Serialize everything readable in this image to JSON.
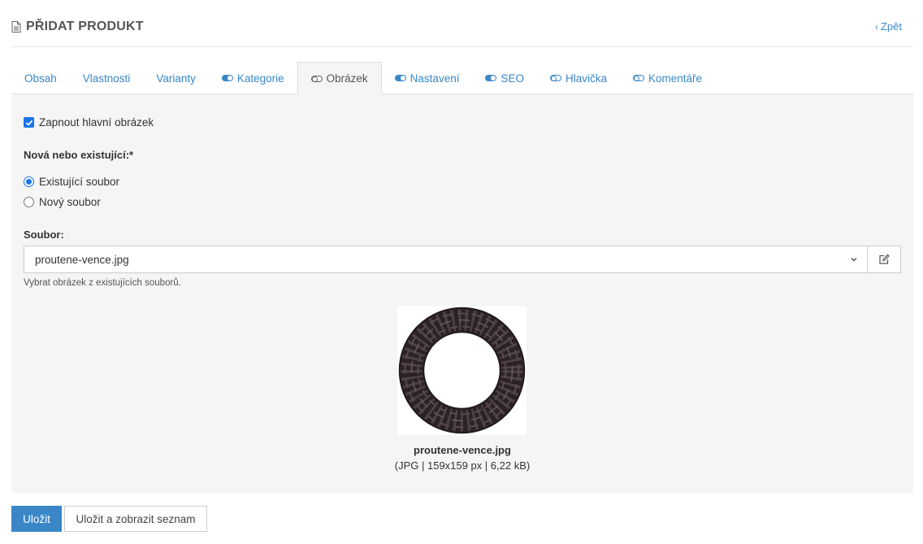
{
  "header": {
    "title": "PŘIDAT PRODUKT",
    "back_label": "Zpět"
  },
  "tabs": [
    {
      "label": "Obsah",
      "toggle": "none",
      "active": false
    },
    {
      "label": "Vlastnosti",
      "toggle": "none",
      "active": false
    },
    {
      "label": "Varianty",
      "toggle": "none",
      "active": false
    },
    {
      "label": "Kategorie",
      "toggle": "on",
      "active": false
    },
    {
      "label": "Obrázek",
      "toggle": "off",
      "active": true
    },
    {
      "label": "Nastavení",
      "toggle": "on",
      "active": false
    },
    {
      "label": "SEO",
      "toggle": "on",
      "active": false
    },
    {
      "label": "Hlavička",
      "toggle": "off",
      "active": false
    },
    {
      "label": "Komentáře",
      "toggle": "off",
      "active": false
    }
  ],
  "form": {
    "enable_main_image_label": "Zapnout hlavní obrázek",
    "enable_main_image_checked": true,
    "source_label": "Nová nebo existující:*",
    "source_options": [
      {
        "label": "Existující soubor",
        "checked": true
      },
      {
        "label": "Nový soubor",
        "checked": false
      }
    ],
    "file_label": "Soubor:",
    "file_value": "proutene-vence.jpg",
    "file_help": "Vybrat obrázek z existujících souborů."
  },
  "preview": {
    "file_name": "proutene-vence.jpg",
    "file_meta": "(JPG | 159x159 px | 6,22 kB)"
  },
  "actions": {
    "save_label": "Uložit",
    "save_list_label": "Uložit a zobrazit seznam"
  },
  "colors": {
    "accent": "#3a87c8",
    "panel_bg": "#f5f5f5"
  }
}
